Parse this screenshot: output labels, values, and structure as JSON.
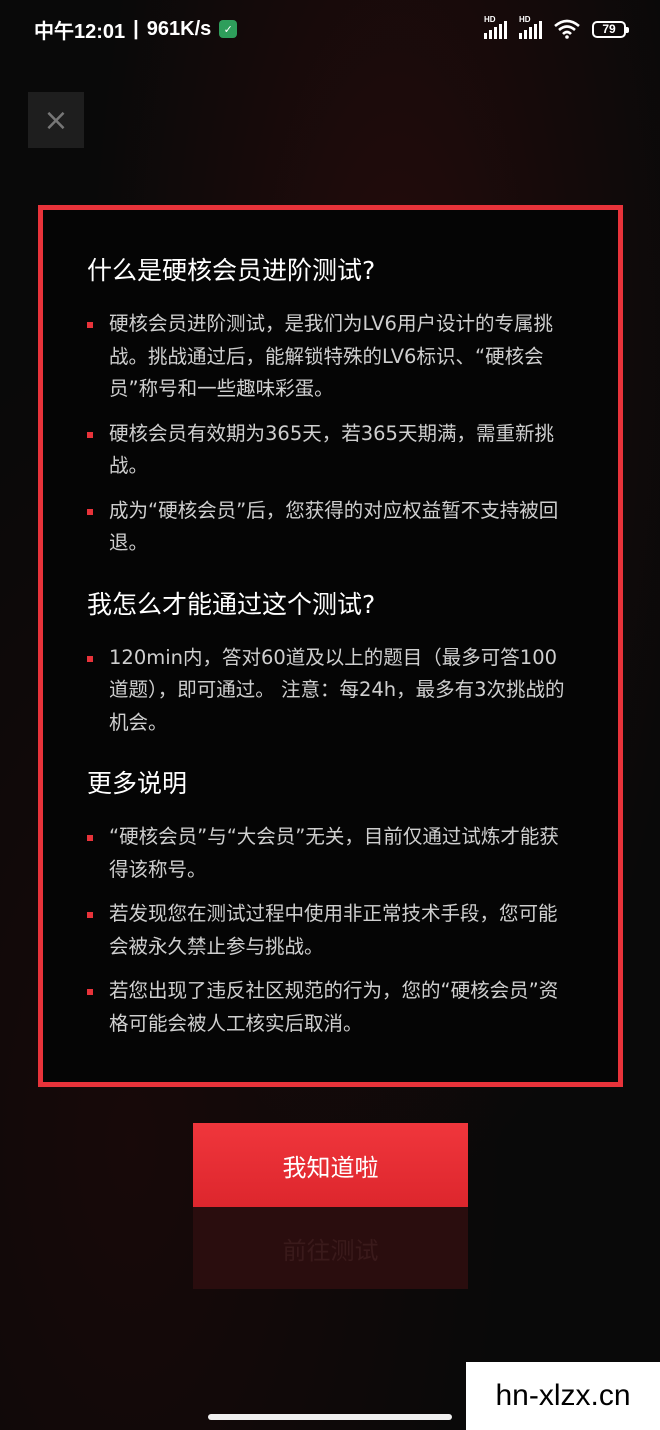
{
  "status_bar": {
    "time": "中午12:01",
    "speed": "961K/s",
    "separator": "|",
    "battery": "79",
    "hd_label": "HD"
  },
  "close_icon": "×",
  "dialog": {
    "sections": [
      {
        "title": "什么是硬核会员进阶测试?",
        "items": [
          "硬核会员进阶测试，是我们为LV6用户设计的专属挑战。挑战通过后，能解锁特殊的LV6标识、“硬核会员”称号和一些趣味彩蛋。",
          "硬核会员有效期为365天，若365天期满，需重新挑战。",
          "成为“硬核会员”后，您获得的对应权益暂不支持被回退。"
        ]
      },
      {
        "title": "我怎么才能通过这个测试?",
        "items": [
          "120min内，答对60道及以上的题目（最多可答100道题），即可通过。 注意：每24h，最多有3次挑战的机会。"
        ]
      },
      {
        "title": "更多说明",
        "items": [
          "“硬核会员”与“大会员”无关，目前仅通过试炼才能获得该称号。",
          "若发现您在测试过程中使用非正常技术手段，您可能会被永久禁止参与挑战。",
          "若您出现了违反社区规范的行为，您的“硬核会员”资格可能会被人工核实后取消。"
        ]
      }
    ]
  },
  "buttons": {
    "confirm_label": "我知道啦",
    "test_label": "前往测试"
  },
  "watermark": "hn-xlzx.cn",
  "colors": {
    "accent": "#e8333a",
    "background": "#090909"
  }
}
